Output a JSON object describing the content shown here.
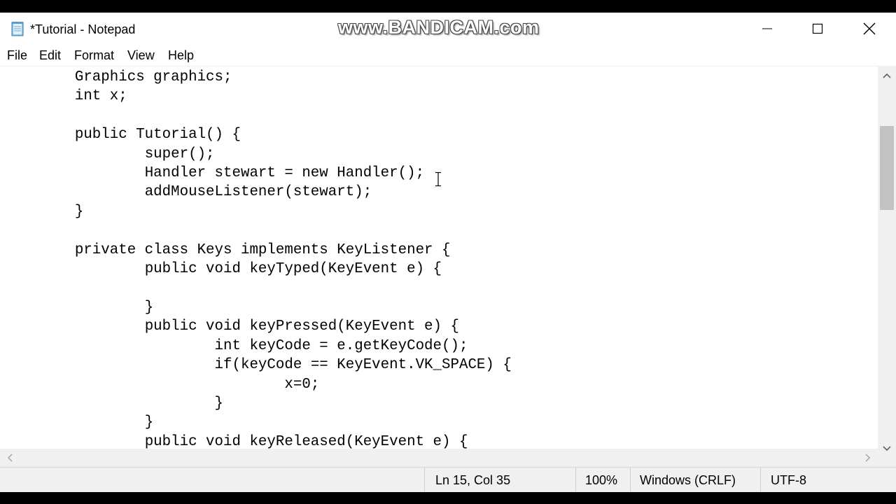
{
  "window": {
    "title": "*Tutorial - Notepad",
    "watermark": "www.BANDICAM.com",
    "app_icon": "notepad-icon"
  },
  "controls": {
    "minimize_icon": "minimize-icon",
    "maximize_icon": "maximize-icon",
    "close_icon": "close-icon"
  },
  "menu": {
    "items": [
      "File",
      "Edit",
      "Format",
      "View",
      "Help"
    ]
  },
  "editor": {
    "lines": [
      "\tGraphics graphics;",
      "\tint x;",
      "",
      "\tpublic Tutorial() {",
      "\t\tsuper();",
      "\t\tHandler stewart = new Handler();",
      "\t\taddMouseListener(stewart);",
      "\t}",
      "",
      "\tprivate class Keys implements KeyListener {",
      "\t\tpublic void keyTyped(KeyEvent e) {",
      "",
      "\t\t}",
      "\t\tpublic void keyPressed(KeyEvent e) {",
      "\t\t\tint keyCode = e.getKeyCode();",
      "\t\t\tif(keyCode == KeyEvent.VK_SPACE) {",
      "\t\t\t\tx=0;",
      "\t\t\t}",
      "\t\t}",
      "\t\tpublic void keyReleased(KeyEvent e) {"
    ]
  },
  "statusbar": {
    "position": "Ln 15, Col 35",
    "zoom": "100%",
    "line_ending": "Windows (CRLF)",
    "encoding": "UTF-8"
  },
  "colors": {
    "background": "#ffffff",
    "chrome": "#f0f0f0",
    "scroll_thumb": "#c2c2c2",
    "text": "#000000"
  }
}
